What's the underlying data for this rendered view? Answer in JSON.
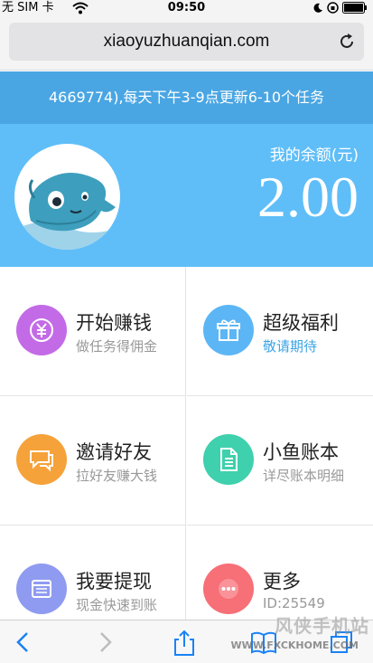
{
  "status_bar": {
    "carrier": "无 SIM 卡",
    "time": "09:50"
  },
  "browser": {
    "url": "xiaoyuzhuanqian.com"
  },
  "notice": {
    "text": "4669774),每天下午3-9点更新6-10个任务"
  },
  "header": {
    "balance_label": "我的余额(元)",
    "balance_value": "2.00"
  },
  "menu": [
    {
      "title": "开始赚钱",
      "subtitle": "做任务得佣金",
      "color": "#c36be6",
      "icon": "yen-icon"
    },
    {
      "title": "超级福利",
      "subtitle": "敬请期待",
      "color": "#5cb6f5",
      "icon": "gift-icon"
    },
    {
      "title": "邀请好友",
      "subtitle": "拉好友赚大钱",
      "color": "#f6a23a",
      "icon": "chat-bubbles-icon"
    },
    {
      "title": "小鱼账本",
      "subtitle": "详尽账本明细",
      "color": "#3fd0ad",
      "icon": "document-icon"
    },
    {
      "title": "我要提现",
      "subtitle": "现金快速到账",
      "color": "#8f9bf0",
      "icon": "wallet-icon"
    },
    {
      "title": "更多",
      "subtitle": "ID:25549",
      "color": "#f76f77",
      "icon": "more-icon"
    }
  ],
  "watermark": {
    "text": "风侠手机站",
    "url": "WWW.FXCKHOME.COM"
  },
  "colors": {
    "notice_bg": "#4aa6e3",
    "header_bg": "#5fbef8",
    "accent": "#3ba3e6"
  }
}
